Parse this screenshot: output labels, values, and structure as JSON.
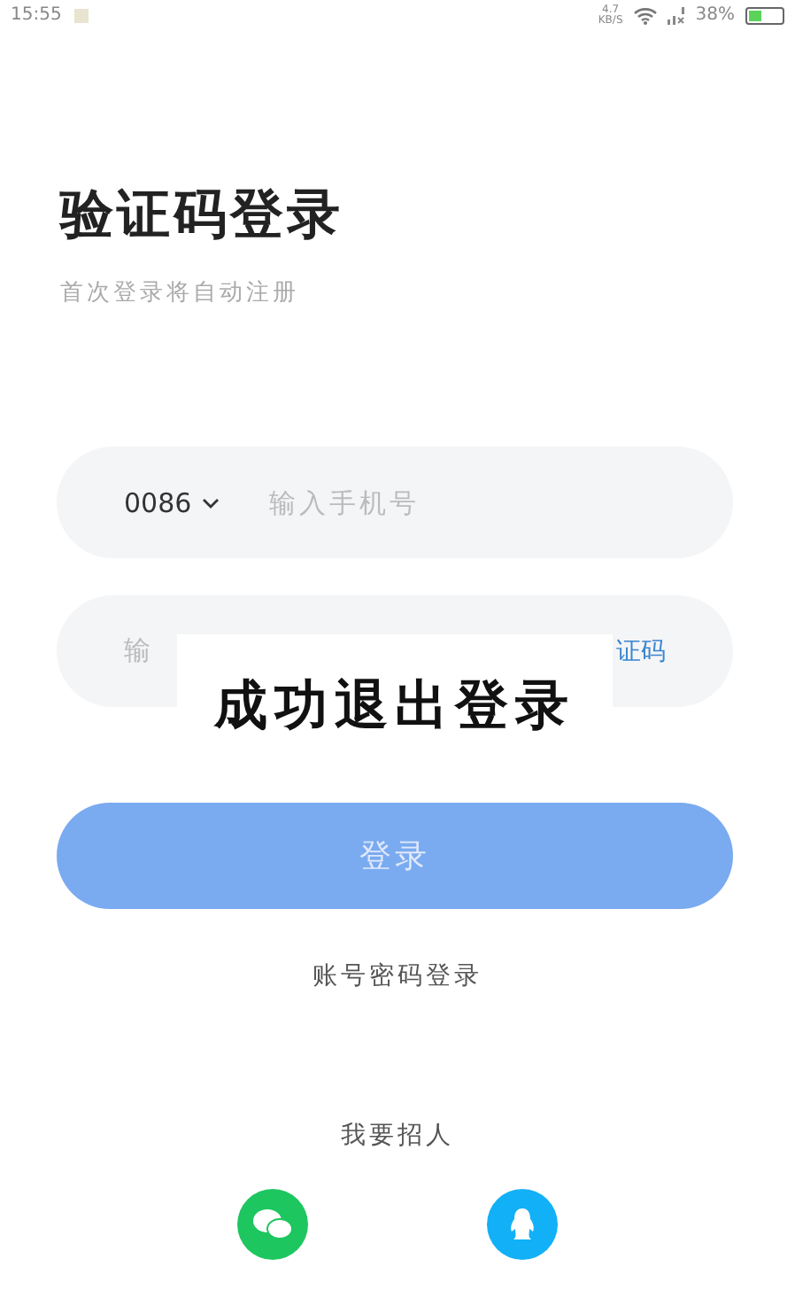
{
  "status_bar": {
    "time": "15:55",
    "speed_value": "4.7",
    "speed_unit": "KB/S",
    "battery": "38%"
  },
  "title": "验证码登录",
  "subtitle": "首次登录将自动注册",
  "phone_field": {
    "country_code": "0086",
    "placeholder": "输入手机号"
  },
  "code_field": {
    "placeholder": "输",
    "get_code_link": "证码"
  },
  "login_button": {
    "label": "登录",
    "disabled": true
  },
  "password_login_link": "账号密码登录",
  "recruit_link": "我要招人",
  "social_logins": [
    {
      "kind": "wechat"
    },
    {
      "kind": "qq"
    }
  ],
  "toast": "成功退出登录"
}
